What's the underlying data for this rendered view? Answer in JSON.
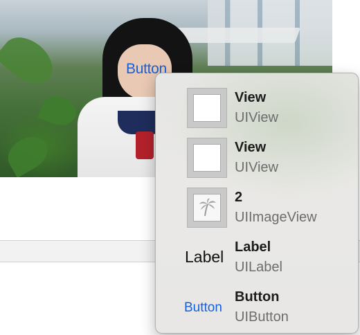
{
  "canvas": {
    "button_label": "Button"
  },
  "colors": {
    "accent": "#1560d8",
    "hud_background": "#e7e7e5"
  },
  "popup": {
    "items": [
      {
        "title": "View",
        "subtitle": "UIView",
        "icon": "view-thumbnail-icon"
      },
      {
        "title": "View",
        "subtitle": "UIView",
        "icon": "view-thumbnail-icon"
      },
      {
        "title": "2",
        "subtitle": "UIImageView",
        "icon": "palm-tree-image-icon"
      },
      {
        "title": "Label",
        "subtitle": "UILabel",
        "icon": "label-glyph",
        "glyph": "Label"
      },
      {
        "title": "Button",
        "subtitle": "UIButton",
        "icon": "button-glyph",
        "glyph": "Button"
      }
    ]
  }
}
